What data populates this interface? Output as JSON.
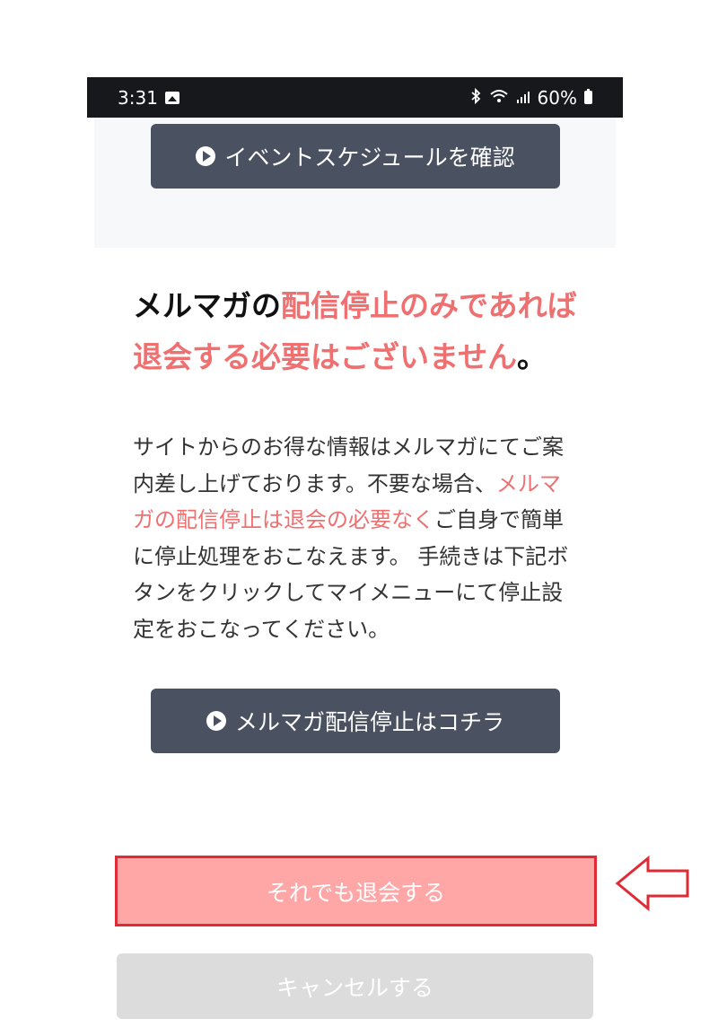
{
  "status_bar": {
    "time": "3:31",
    "battery": "60%",
    "icons": [
      "photo-icon",
      "bluetooth-icon",
      "wifi-icon",
      "signal-icon",
      "battery-icon"
    ]
  },
  "buttons": {
    "event_schedule": "イベントスケジュールを確認",
    "newsletter_stop": "メルマガ配信停止はコチラ",
    "withdraw": "それでも退会する",
    "cancel": "キャンセルする"
  },
  "headline": {
    "part1": "メルマガの",
    "part2_red": "配信停止のみであれば退会する必要はございません",
    "part3": "。"
  },
  "body": {
    "part1": "サイトからのお得な情報はメルマガにてご案内差し上げております。不要な場合、",
    "part2_red": "メルマガの配信停止は退会の必要なく",
    "part3": "ご自身で簡単に停止処理をおこなえます。 手続きは下記ボタンをクリックしてマイメニューにて停止設定をおこなってください。"
  },
  "colors": {
    "accent_red": "#ee7070",
    "dark_button": "#4a5160",
    "withdraw_bg": "#ffa7a7",
    "highlight_border": "#e02b36",
    "cancel_bg": "#dcdcdc"
  }
}
